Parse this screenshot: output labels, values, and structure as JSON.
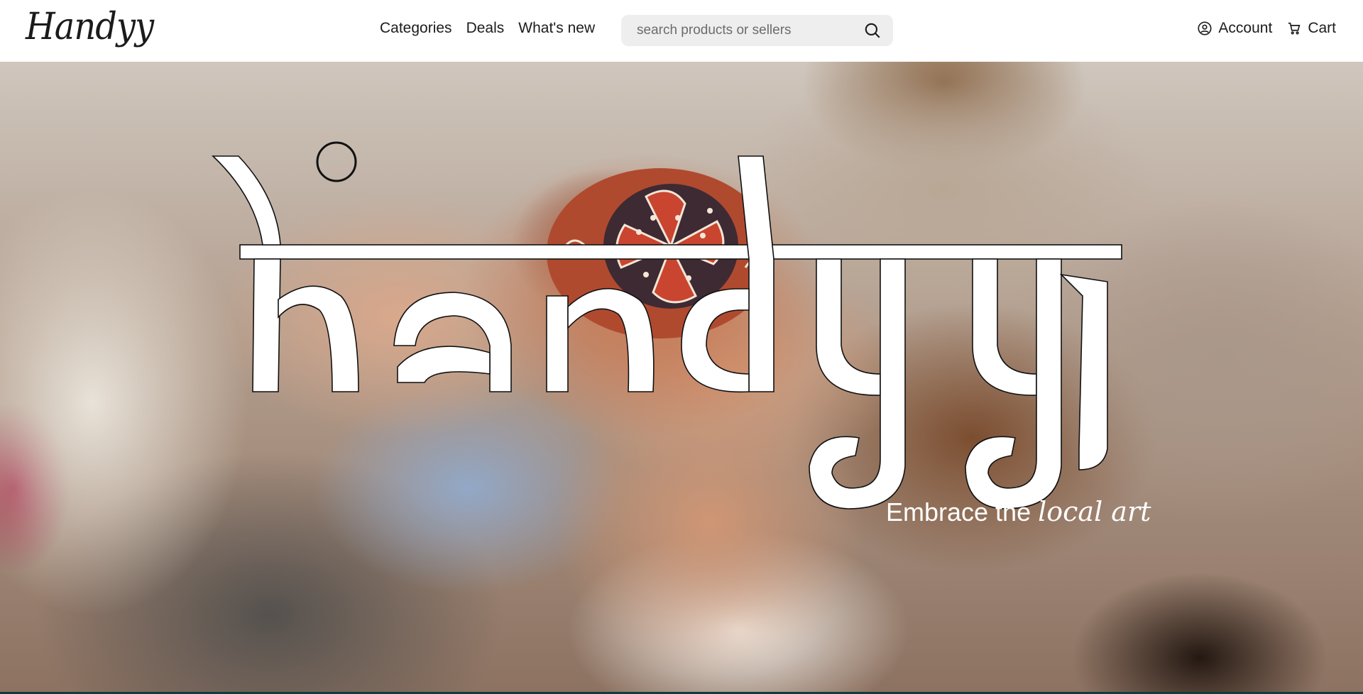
{
  "navbar": {
    "logo_text": "Handyy",
    "links": [
      "Categories",
      "Deals",
      "What's new"
    ],
    "search": {
      "placeholder": "search products or sellers",
      "icon": "search-icon"
    },
    "account_label": "Account",
    "account_icon": "user-circle-icon",
    "cart_label": "Cart",
    "cart_icon": "cart-icon"
  },
  "hero": {
    "wordmark": "handyy",
    "tagline": "Embrace the",
    "tagline_script": "local art",
    "colors": {
      "text": "#ffffff",
      "outline": "#111111",
      "bottom_bar": "#0f3d3e"
    }
  }
}
